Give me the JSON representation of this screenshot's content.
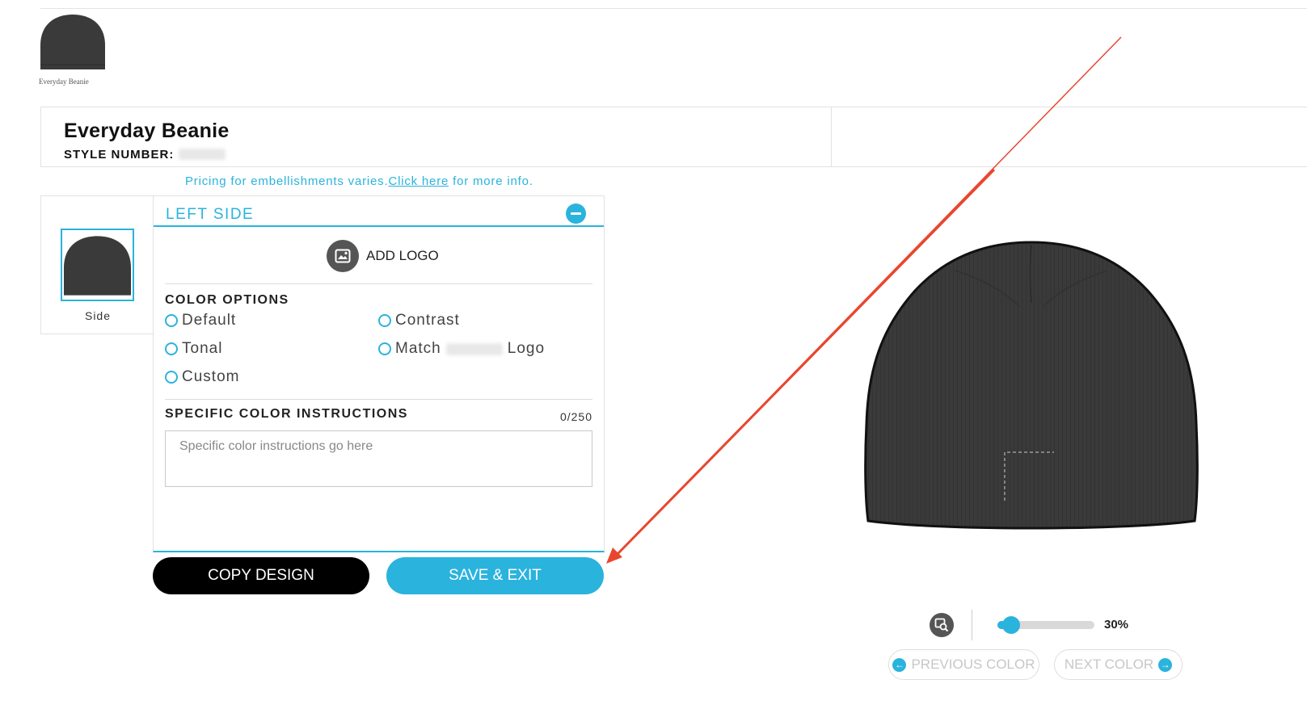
{
  "product": {
    "thumb_caption": "Everyday Beanie",
    "title": "Everyday Beanie",
    "style_label": "STYLE NUMBER:"
  },
  "pricing_note": {
    "prefix": "Pricing for embellishments varies.",
    "link": "Click here",
    "suffix": " for more info."
  },
  "views": [
    {
      "label": "Side",
      "selected": true
    }
  ],
  "editor": {
    "section_title": "LEFT SIDE",
    "add_logo_label": "ADD LOGO",
    "color_options_label": "COLOR OPTIONS",
    "options": {
      "default": "Default",
      "contrast": "Contrast",
      "tonal": "Tonal",
      "match_prefix": "Match",
      "match_suffix": "Logo",
      "custom": "Custom"
    },
    "instructions_label": "SPECIFIC COLOR INSTRUCTIONS",
    "counter": "0/250",
    "instructions_placeholder": "Specific color instructions go here"
  },
  "actions": {
    "copy_label": "COPY DESIGN",
    "save_label": "SAVE & EXIT"
  },
  "preview": {
    "zoom_text": "30%",
    "zoom_level": 0.05,
    "prev_label": "PREVIOUS COLOR",
    "next_label": "NEXT COLOR",
    "accent": "#2ab3dd",
    "hat_color": "#3a3a3a",
    "annotation_color": "#e8472f"
  },
  "icons": {
    "collapse": "minus-circle-icon",
    "add_logo": "image-icon",
    "zoom_tool": "zoom-image-icon",
    "prev": "arrow-left-circle-icon",
    "next": "arrow-right-circle-icon"
  }
}
